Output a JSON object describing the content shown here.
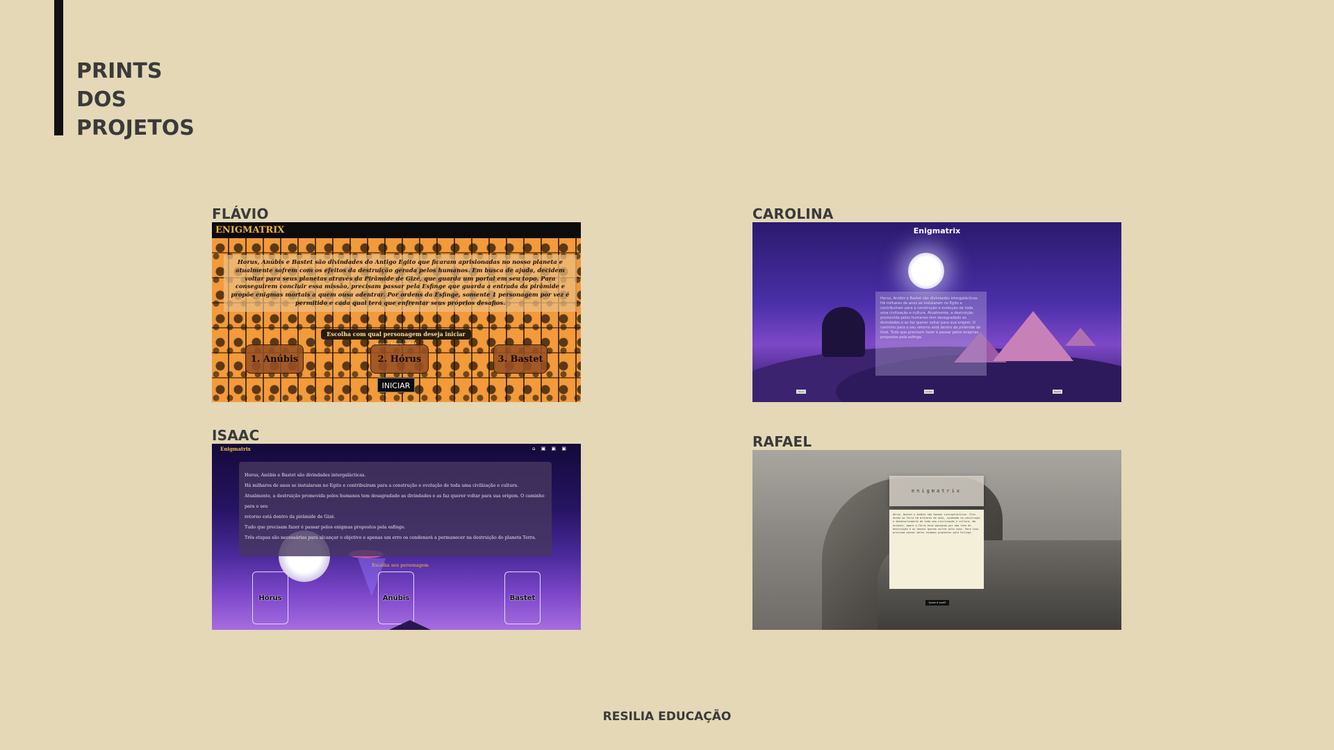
{
  "page": {
    "title_lines": [
      "PRINTS",
      "DOS",
      "PROJETOS"
    ],
    "footer": "RESILIA EDUCAÇÃO"
  },
  "cards": {
    "flavio": {
      "label": "FLÁVIO",
      "brand": "ENIGMATRIX",
      "story": "Horus, Anúbis e Bastet são divindades do Antigo Egito que ficaram aprisionadas no nosso planeta e atualmente sofrem com os efeitos da destruição gerada pelos humanos. Em busca de ajuda, decidem voltar para seus planetas através da Pirâmide de Gizé, que guarda um portal em seu topo. Para conseguirem concluir essa missão, precisam passar pela Esfinge que guarda a entrada da pirâmide e propõe enigmas mortais a quem ousa adentrar. Por ordens da Esfinge, somente 1 personagem por vez é permitido e cada qual terá que enfrentar seus próprios desafios.",
      "prompt": "Escolha com qual personagem deseja iniciar essa jornada!",
      "characters": [
        "1. Anúbis",
        "2. Hórus",
        "3. Bastet"
      ],
      "start_button": "INICIAR"
    },
    "carolina": {
      "label": "CAROLINA",
      "title": "Enigmatrix",
      "story": "Horus, Anúbis e Bastet são divindades intergalácticas. Há milhares de anos se instalaram no Egito e contribuíram para a construção e evolução de toda uma civilização e cultura. Atualmente, a destruição promovida pelos humanos tem desagradado as divindades e as faz querer voltar para sua origem. O caminho para o seu retorno está dentro da pirâmide de Gizé. Tudo que precisam fazer é passar pelos enigmas propostos pela esfinge.",
      "buttons": [
        "Hórus",
        "Anúbis",
        "Bastet"
      ]
    },
    "isaac": {
      "label": "ISAAC",
      "brand": "Enigmatrix",
      "nav_icons": "⌂ ▣ ▣ ▣",
      "paragraphs": [
        "Horus, Anúbis e Bastet são divindades intergalácticas.",
        "Há milhares de anos se instalaram no Egito e contribuíram para a construção e evolução de toda uma civilização e cultura.",
        "Atualmente, a destruição promovida pelos humanos tem desagradado as divindades e as faz querer voltar para sua origem. O caminho para o seu",
        "retorno está dentro da pirâmide de Gizé.",
        "Tudo que precisam fazer é passar pelos enigmas propostos pela esfinge.",
        "Três etapas são necessárias para alcançar o objetivo e apenas um erro os condenará a permanecer na destruição do planeta Terra."
      ],
      "choose": "Escolha seu personagem",
      "characters": [
        "Hórus",
        "Anúbis",
        "Bastet"
      ]
    },
    "rafael": {
      "label": "RAFAEL",
      "title": "enigmatrix",
      "story": "Hórus, Bastet e Anúbis são deuses intergalácticos. Eles estão na Terra há milhares de anos, ajudando na construção e desenvolvimento de toda uma civilização e cultura. No entanto, agora a Terra está passando por uma fase de destruição e os deuses querem voltar para casa. Para isso precisam passar pelos enigmas propostos pela Esfinge.",
      "button": "Quem é você?"
    }
  },
  "colors": {
    "background": "#e4d8b7",
    "accent_bar": "#111111"
  }
}
